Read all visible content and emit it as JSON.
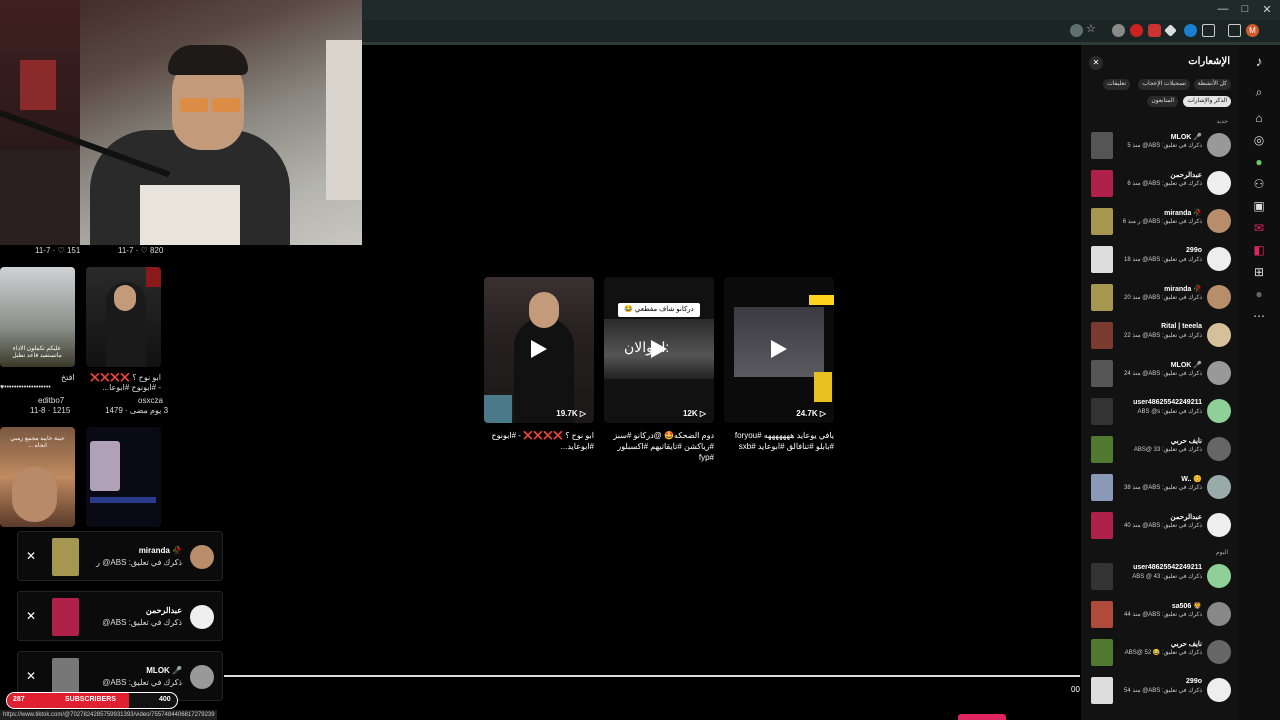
{
  "browser": {
    "window_controls": [
      "—",
      "□",
      "✕"
    ],
    "profile_initial": "M"
  },
  "grid": {
    "row1_stats": [
      {
        "date": "11-7",
        "likes": "151"
      },
      {
        "date": "11-7",
        "likes": "820"
      }
    ],
    "tiles": [
      {
        "caption": "افتخ",
        "user": "editbo7",
        "meta": "11-8 · 1215",
        "overlay": "عليكم تكملون الاداء  ماتستفيد قاعد تطبل"
      },
      {
        "caption": "ابو نوح ؟ ❌❌❌❌ - #ابونوح #ابوعا...",
        "user": "osxcza",
        "meta": "3 يوم مضى · 1479",
        "overlay": ""
      }
    ],
    "tile3_overlay": "خيبة خايبه مجمع رمبي اتحاه ..."
  },
  "videos": [
    {
      "count": "19.7K",
      "caption": "ابو نوح ؟ ❌❌❌❌ - #ابونوح #ابوعايد...",
      "overlay": ""
    },
    {
      "count": "12K",
      "caption": "دوم الضحكه🤩 @دركانو #سبز #رياكشن #تايقاتيهم #اكسبلور #fyp",
      "overlay": "دركانو شاف مقطعي 😂",
      "overlay2": "انبوالان:"
    },
    {
      "count": "24.7K",
      "caption": "يافي يوعايد هههههههه #foryou #بابلو #تنافالق #ابوعايد #sxb",
      "overlay": ""
    }
  ],
  "notifications": {
    "title": "الإشعارات",
    "chips": [
      "كل الأنشطة",
      "تسجيلات الإعجاب",
      "تعليقات",
      "الذكر والإشارات",
      "المتابعون"
    ],
    "section_new": "جديد",
    "section_today": "اليوم",
    "items": [
      {
        "name": "MLOK 🎤",
        "text": "ذكرك في تعليق: ABS@ منذ 5",
        "thumb": "#555",
        "avatar": "#999"
      },
      {
        "name": "عبدالرحمن",
        "text": "ذكرك في تعليق: ABS@ منذ 6",
        "thumb": "#b0214a",
        "avatar": "#eee"
      },
      {
        "name": "miranda 🥀",
        "text": "ذكرك في تعليق: ABS@ ر منذ 6",
        "thumb": "#a5974f",
        "avatar": "#b88d6a"
      },
      {
        "name": "299o",
        "text": "ذكرك في تعليق: ABS@ منذ 18",
        "thumb": "#ddd",
        "avatar": "#eee"
      },
      {
        "name": "miranda 🥀",
        "text": "ذكرك في تعليق: ABS@ منذ 20",
        "thumb": "#a5974f",
        "avatar": "#b88d6a"
      },
      {
        "name": "Rital | teeela",
        "text": "ذكرك في تعليق: ABS@ منذ 22",
        "thumb": "#7a3b2e",
        "avatar": "#d6c09a"
      },
      {
        "name": "MLOK 🎤",
        "text": "ذكرك في تعليق: ABS@ منذ 24",
        "thumb": "#555",
        "avatar": "#999"
      },
      {
        "name": "user48625542249211",
        "text": "ذكرك في تعليق: ABS @s",
        "thumb": "#333",
        "avatar": "#8fcf98"
      },
      {
        "name": "نايف حربي",
        "text": "ذكرك في تعليق: ABS@ 33",
        "thumb": "#4f7a30",
        "avatar": "#666"
      },
      {
        "name": "W.. 😊",
        "text": "ذكرك في تعليق: ABS@ منذ 38",
        "thumb": "#8a99b8",
        "avatar": "#9aa"
      },
      {
        "name": "عبدالرحمن",
        "text": "ذكرك في تعليق: ABS@ منذ 40",
        "thumb": "#b0214a",
        "avatar": "#eee"
      },
      {
        "name": "user48625542249211",
        "text": "ذكرك في تعليق: ABS @ 43",
        "thumb": "#333",
        "avatar": "#8fcf98"
      },
      {
        "name": "sa506 🦁",
        "text": "ذكرك في تعليق: ABS@ منذ 44",
        "thumb": "#b04a3a",
        "avatar": "#888"
      },
      {
        "name": "نايف حربي",
        "text": "ذكرك في تعليق: 😂 ABS@ 52",
        "thumb": "#4f7a30",
        "avatar": "#666"
      },
      {
        "name": "299o",
        "text": "ذكرك في تعليق: ABS@ منذ 54",
        "thumb": "#ddd",
        "avatar": "#eee"
      }
    ]
  },
  "toasts": [
    {
      "name": "miranda 🥀",
      "text": "ذكرك في تعليق: ABS@ ر",
      "thumb": "#a5974f",
      "avatar": "#b88d6a"
    },
    {
      "name": "عبدالرحمن",
      "text": "ذكرك في تعليق: ABS@",
      "thumb": "#b0214a",
      "avatar": "#eee"
    },
    {
      "name": "MLOK 🎤",
      "text": "ذكرك في تعليق: ABS@",
      "thumb": "#777",
      "avatar": "#999"
    }
  ],
  "subscribers": {
    "current": "287",
    "label": "SUBSCRIBERS",
    "goal": "400",
    "progress": 0.72
  },
  "status_url": "https://www.tiktok.com/@702782428575993139​3/video/7557484406817279239",
  "progress_time": "00"
}
